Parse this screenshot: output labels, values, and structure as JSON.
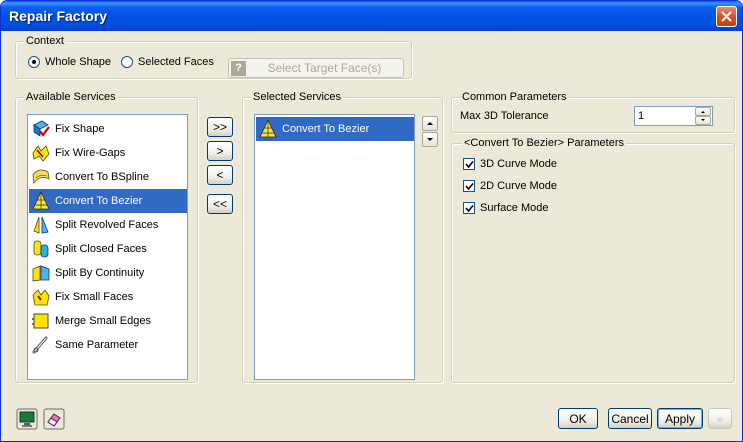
{
  "window": {
    "title": "Repair Factory"
  },
  "context": {
    "label": "Context",
    "options": [
      {
        "label": "Whole Shape",
        "selected": true
      },
      {
        "label": "Selected Faces",
        "selected": false
      }
    ],
    "target_button": "Select Target Face(s)"
  },
  "available": {
    "label": "Available Services",
    "items": [
      {
        "label": "Fix Shape",
        "icon": "fix-shape-icon",
        "selected": false
      },
      {
        "label": "Fix Wire-Gaps",
        "icon": "fix-wire-gaps-icon",
        "selected": false
      },
      {
        "label": "Convert To BSpline",
        "icon": "convert-to-bspline-icon",
        "selected": false
      },
      {
        "label": "Convert To Bezier",
        "icon": "convert-to-bezier-icon",
        "selected": true
      },
      {
        "label": "Split Revolved Faces",
        "icon": "split-revolved-faces-icon",
        "selected": false
      },
      {
        "label": "Split Closed Faces",
        "icon": "split-closed-faces-icon",
        "selected": false
      },
      {
        "label": "Split By Continuity",
        "icon": "split-by-continuity-icon",
        "selected": false
      },
      {
        "label": "Fix Small Faces",
        "icon": "fix-small-faces-icon",
        "selected": false
      },
      {
        "label": "Merge Small Edges",
        "icon": "merge-small-edges-icon",
        "selected": false
      },
      {
        "label": "Same Parameter",
        "icon": "same-parameter-icon",
        "selected": false
      }
    ]
  },
  "transfer": {
    "add_all": ">>",
    "add": ">",
    "remove": "<",
    "remove_all": "<<"
  },
  "selected": {
    "label": "Selected Services",
    "items": [
      {
        "label": "Convert To Bezier",
        "icon": "convert-to-bezier-icon",
        "selected": true
      }
    ]
  },
  "common": {
    "label": "Common Parameters",
    "tolerance_label": "Max 3D Tolerance",
    "tolerance_value": "1"
  },
  "bezier_params": {
    "label": "<Convert To Bezier> Parameters",
    "checks": [
      {
        "label": "3D Curve Mode",
        "checked": true
      },
      {
        "label": "2D Curve Mode",
        "checked": true
      },
      {
        "label": "Surface Mode",
        "checked": true
      }
    ]
  },
  "footer": {
    "ok": "OK",
    "cancel": "Cancel",
    "apply": "Apply",
    "next": "»"
  },
  "colors": {
    "selection": "#316ac5",
    "title_bar": "#0054e3",
    "dialog_bg": "#ece9d8"
  }
}
